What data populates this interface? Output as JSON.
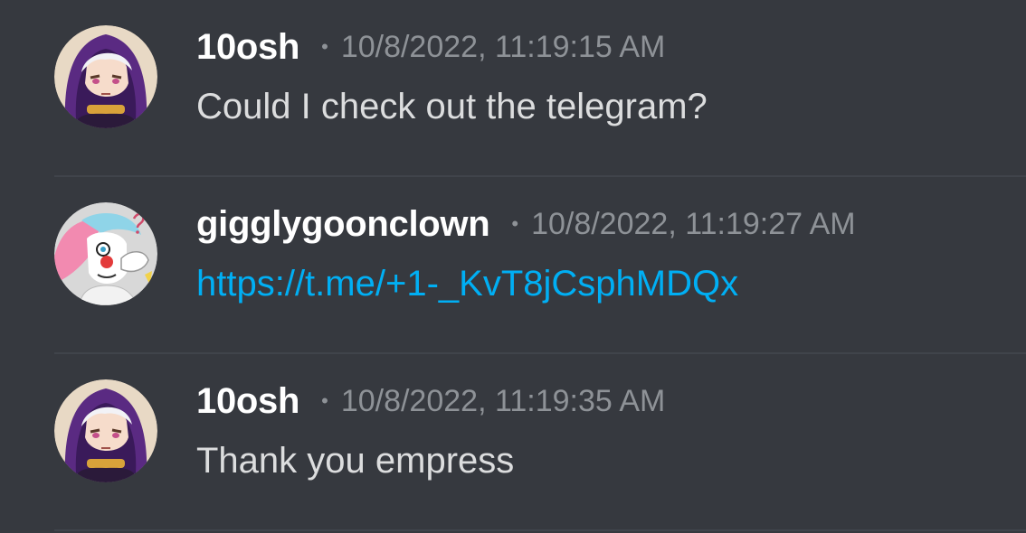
{
  "messages": [
    {
      "username": "10osh",
      "separator": "•",
      "timestamp": "10/8/2022, 11:19:15 AM",
      "text": "Could I check out the telegram?",
      "avatar_icon": "avatar-hooded-character"
    },
    {
      "username": "gigglygoonclown",
      "separator": "•",
      "timestamp": "10/8/2022, 11:19:27 AM",
      "link": "https://t.me/+1-_KvT8jCsphMDQx",
      "avatar_icon": "avatar-clown-character"
    },
    {
      "username": "10osh",
      "separator": "•",
      "timestamp": "10/8/2022, 11:19:35 AM",
      "text": "Thank you empress",
      "avatar_icon": "avatar-hooded-character"
    }
  ],
  "colors": {
    "background": "#36393f",
    "username": "#ffffff",
    "timestamp": "#8e9297",
    "message_text": "#dcddde",
    "link": "#00aff4",
    "divider": "#40444b"
  }
}
